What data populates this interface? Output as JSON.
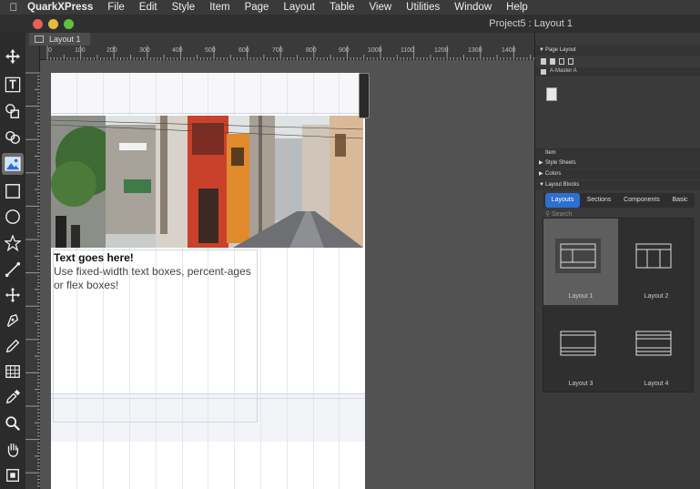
{
  "menubar": {
    "app": "QuarkXPress",
    "items": [
      "File",
      "Edit",
      "Style",
      "Item",
      "Page",
      "Layout",
      "Table",
      "View",
      "Utilities",
      "Window",
      "Help"
    ]
  },
  "window": {
    "title": "Project5 : Layout 1"
  },
  "tab": {
    "label": "Layout 1"
  },
  "ruler": {
    "labels": [
      "0",
      "100",
      "200",
      "300",
      "400",
      "500",
      "600",
      "700",
      "800",
      "900",
      "1000",
      "1100",
      "1200",
      "1300",
      "1400"
    ]
  },
  "page": {
    "heading": "Text goes here!",
    "body": "Use fixed-width text boxes, percent-ages or flex boxes!"
  },
  "panel": {
    "page_layout_title": "Page Layout",
    "master_label": "A-Master A",
    "item_title": "Item",
    "style_sheets_title": "Style Sheets",
    "colors_title": "Colors",
    "layout_blocks_title": "Layout Blocks",
    "tabs": [
      "Layouts",
      "Sections",
      "Components",
      "Basic"
    ],
    "search_placeholder": "Search",
    "layouts": [
      "Layout 1",
      "Layout 2",
      "Layout 3",
      "Layout 4"
    ]
  },
  "colors": {
    "accent": "#2e6fd0",
    "page": "#ffffff",
    "pasteboard": "#525252"
  }
}
